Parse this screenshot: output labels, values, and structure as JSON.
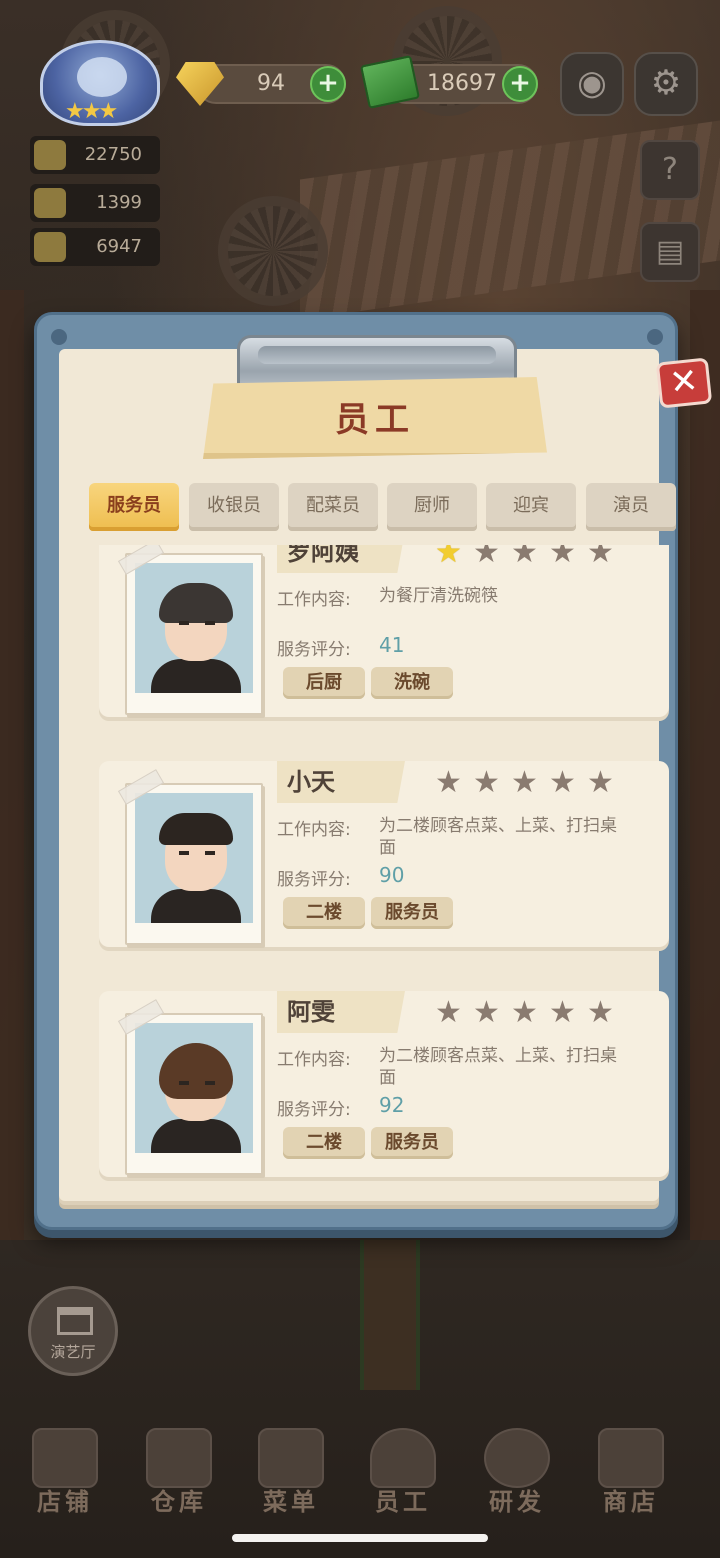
{
  "hud": {
    "gems": "94",
    "cash": "18697",
    "plus_symbol": "+",
    "stats": [
      "22750",
      "1399",
      "6947"
    ]
  },
  "panel": {
    "title": "员工",
    "close_symbol": "✕",
    "tabs": [
      {
        "label": "服务员",
        "active": true
      },
      {
        "label": "收银员",
        "active": false
      },
      {
        "label": "配菜员",
        "active": false
      },
      {
        "label": "厨师",
        "active": false
      },
      {
        "label": "迎宾",
        "active": false
      },
      {
        "label": "演员",
        "active": false
      }
    ],
    "job_label": "工作内容:",
    "rating_label": "服务评分:",
    "staff": [
      {
        "name": "罗阿姨",
        "stars": 1,
        "max_stars": 5,
        "job": "为餐厅清洗碗筷",
        "rating": "41",
        "tags": [
          "后厨",
          "洗碗"
        ]
      },
      {
        "name": "小天",
        "stars": 0,
        "max_stars": 5,
        "job": "为二楼顾客点菜、上菜、打扫桌面",
        "rating": "90",
        "tags": [
          "二楼",
          "服务员"
        ]
      },
      {
        "name": "阿雯",
        "stars": 0,
        "max_stars": 5,
        "job": "为二楼顾客点菜、上菜、打扫桌面",
        "rating": "92",
        "tags": [
          "二楼",
          "服务员"
        ]
      }
    ]
  },
  "side_buttons": {
    "theater_label": "演艺厅"
  },
  "bottom_nav": [
    {
      "label": "店铺"
    },
    {
      "label": "仓库"
    },
    {
      "label": "菜单"
    },
    {
      "label": "员工"
    },
    {
      "label": "研发"
    },
    {
      "label": "商店"
    }
  ],
  "icons": {
    "camera": "camera-icon",
    "settings": "gear-icon",
    "help_book": "help-book-icon",
    "recipe_book": "recipe-book-icon"
  },
  "colors": {
    "active_tab": "#eebd4e",
    "star_on": "#f2cd2f",
    "star_off": "#8a7b70",
    "rating": "#5f9fa7",
    "close": "#c73d3a"
  }
}
